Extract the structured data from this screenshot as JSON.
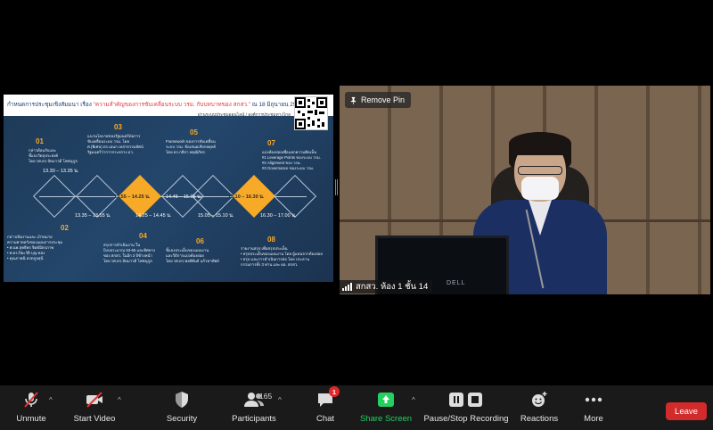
{
  "shared_slide": {
    "title_prefix": "กำหนดการประชุมเชิงสัมมนา เรื่อง ",
    "title_highlight": "\"ความสำคัญของการขับเคลื่อนระบบ วรม. กับบทบาทของ สกสว.\"",
    "title_date": " ณ 18 มิถุนายน 2564",
    "organizer": "ผ่านระบบประชุมออนไลน์ / องค์การประชุมทางไกล",
    "steps": [
      {
        "num": "01",
        "text": "กล่าวต้อนรับและ\nชี้แจงวัตถุประสงค์\nโดย รศ.ดร.ปัทมาวดี โพชนุกูล"
      },
      {
        "num": "02",
        "text": "กล่าวเปิดงานและ เป้าหมาย\nความคาดหวังของแผนการประชุม\n• ศ.นพ.สุทธิพร จิตต์มิตรภาพ\n• ศ.ดร.ปิยะวัติ บุญ-หลง\n• คุณภาคนิ ตรตกูลสุนี"
      },
      {
        "num": "03",
        "text": "แนวนโยบายของรัฐมนตรีต่อการ\nขับเคลื่อนระบบ วรม. โดย\nศ.(พิเศษ) ดร.เอนก เหล่าธรรมทัศน์\nรัฐมนตรีว่าการกระทรวง อว."
      },
      {
        "num": "04",
        "text": "สรุปการดำเนินงาน ใน\nปีงบประมาณ 63-65 และทิศทาง\nของ สกสว. ในอีก 3 ปีข้างหน้า\nโดย รศ.ดร.ปัทมาวดี โพชนุกูล"
      },
      {
        "num": "05",
        "text": "Framework ของการขับเคลื่อน\nระบบ วรม. ข้อเสนอเชิงกลยุทธ์\nโดย ดร.กติกา พฤฒิภัทร"
      },
      {
        "num": "06",
        "text": "ชี้แจงประเด็นของแผนงาน\nและวิธีการแบ่งห้องย่อย\nโดย รศ.ดร.พงศ์พันธ์ แก้วหาทัพย์"
      },
      {
        "num": "07",
        "text": "แบ่งห้องย่อยเพื่อแลกความคิดเห็น\n#1 Leverage Points ของระบบ วรม.\n#2 Alignment ของ วรม.\n#3 Governance ของระบบ วรม."
      },
      {
        "num": "08",
        "text": "รายงานสรุป เพื่อสรุปประเด็น\n• สรุปประเด็นของแผนงาน โดย ผู้แทนจากห้องย่อย\n• สรุป และการดำเนินการต่อ โดย ประธาน\nกรรมการทั้ง 3 ท่าน และ ผอ. สกสว."
      }
    ],
    "times": {
      "t1": "13.30 – 13.35 น.",
      "t2": "13.35 – 13.55 น.",
      "t3": "13.55 – 14.25 น.",
      "t4": "14.25 – 14.45 น.",
      "t5": "14.45 – 15.05 น.",
      "t6": "15.05 – 15.10 น.",
      "t7": "15.10 – 16.30 น.",
      "t8": "16.30 – 17.00 น."
    }
  },
  "video": {
    "remove_pin_label": "Remove Pin",
    "participant_name": "สกสว. ห้อง 1 ชั้น 14",
    "monitor_brand": "DELL"
  },
  "toolbar": {
    "unmute": "Unmute",
    "start_video": "Start Video",
    "security": "Security",
    "participants": "Participants",
    "participants_count": "165",
    "chat": "Chat",
    "chat_badge": "1",
    "share_screen": "Share Screen",
    "recording": "Pause/Stop Recording",
    "reactions": "Reactions",
    "more": "More",
    "leave": "Leave"
  },
  "colors": {
    "toolbar_bg": "#1a1a1a",
    "leave_red": "#d12b2b",
    "share_green": "#23d160",
    "slide_orange": "#f7a928",
    "slide_navy": "#1e3a58"
  }
}
